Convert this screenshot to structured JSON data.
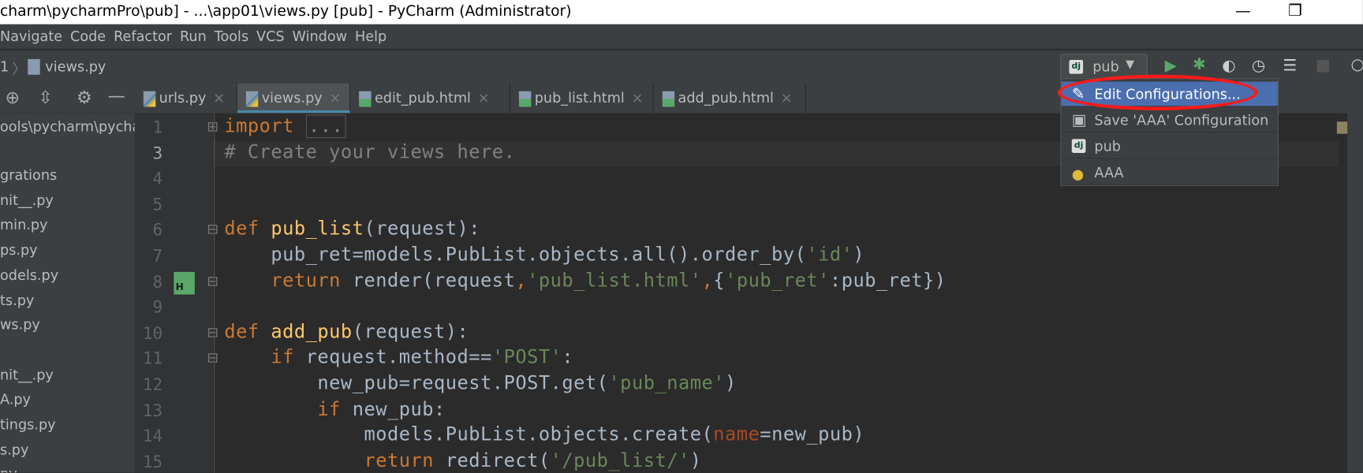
{
  "window": {
    "title": "charm\\pycharmPro\\pub] - ...\\app01\\views.py [pub] - PyCharm (Administrator)",
    "minimize": "—",
    "maximize": "❐"
  },
  "menu": [
    "Navigate",
    "Code",
    "Refactor",
    "Run",
    "Tools",
    "VCS",
    "Window",
    "Help"
  ],
  "breadcrumb": {
    "prefix": "1",
    "file": "views.py"
  },
  "run_config": {
    "selected": "pub",
    "icon": "django-icon"
  },
  "toolbar_icons": [
    "run-icon",
    "debug-icon",
    "coverage-icon",
    "profile-icon",
    "concurrency-icon",
    "stop-icon",
    "search-icon"
  ],
  "accent": "#4b6eaf",
  "highlight_ring": "#ff1a1a",
  "sidebar": {
    "path": "ools\\pycharm\\pycha",
    "items": [
      "grations",
      "nit__.py",
      "min.py",
      "ps.py",
      "odels.py",
      "ts.py",
      "ws.py",
      "",
      "nit__.py",
      "A.py",
      "tings.py",
      "s.py",
      "pv"
    ]
  },
  "tabs": [
    {
      "label": "urls.py",
      "type": "python"
    },
    {
      "label": "views.py",
      "type": "python",
      "active": true
    },
    {
      "label": "edit_pub.html",
      "type": "html"
    },
    {
      "label": "pub_list.html",
      "type": "html"
    },
    {
      "label": "add_pub.html",
      "type": "html"
    }
  ],
  "popup": [
    {
      "label": "Edit Configurations...",
      "icon": "pencil-icon",
      "selected": true
    },
    {
      "label": "Save 'AAA' Configuration",
      "icon": "save-icon"
    },
    {
      "label": "pub",
      "icon": "django-icon"
    },
    {
      "label": "AAA",
      "icon": "python-icon"
    }
  ],
  "code": [
    {
      "n": "1",
      "tokens": [
        [
          "kw",
          "import "
        ],
        [
          "fold",
          "..."
        ]
      ]
    },
    {
      "n": "3",
      "tokens": [
        [
          "cm",
          "# Create your views here."
        ]
      ]
    },
    {
      "n": "4",
      "tokens": []
    },
    {
      "n": "5",
      "tokens": []
    },
    {
      "n": "6",
      "tokens": [
        [
          "kw",
          "def "
        ],
        [
          "fn",
          "pub_list"
        ],
        [
          "txt",
          "(request):"
        ]
      ]
    },
    {
      "n": "7",
      "tokens": [
        [
          "txt",
          "    pub_ret=models.PubList.objects.all().order_by("
        ],
        [
          "str",
          "'id'"
        ],
        [
          "txt",
          ")"
        ]
      ]
    },
    {
      "n": "8",
      "tokens": [
        [
          "txt",
          "    "
        ],
        [
          "kw",
          "return "
        ],
        [
          "txt",
          "render(request"
        ],
        [
          "kw",
          ","
        ],
        [
          "str",
          "'pub_list.html'"
        ],
        [
          "kw",
          ","
        ],
        [
          "txt",
          "{"
        ],
        [
          "str",
          "'pub_ret'"
        ],
        [
          "txt",
          ":pub_ret})"
        ]
      ]
    },
    {
      "n": "9",
      "tokens": []
    },
    {
      "n": "10",
      "tokens": [
        [
          "kw",
          "def "
        ],
        [
          "fn",
          "add_pub"
        ],
        [
          "txt",
          "(request):"
        ]
      ]
    },
    {
      "n": "11",
      "tokens": [
        [
          "txt",
          "    "
        ],
        [
          "kw",
          "if "
        ],
        [
          "txt",
          "request.method=="
        ],
        [
          "str",
          "'POST'"
        ],
        [
          "txt",
          ":"
        ]
      ]
    },
    {
      "n": "12",
      "tokens": [
        [
          "txt",
          "        new_pub=request.POST.get("
        ],
        [
          "str",
          "'pub_name'"
        ],
        [
          "txt",
          ")"
        ]
      ]
    },
    {
      "n": "13",
      "tokens": [
        [
          "txt",
          "        "
        ],
        [
          "kw",
          "if "
        ],
        [
          "txt",
          "new_pub:"
        ]
      ]
    },
    {
      "n": "14",
      "tokens": [
        [
          "txt",
          "            models.PubList.objects.create("
        ],
        [
          "pa",
          "name"
        ],
        [
          "txt",
          "=new_pub)"
        ]
      ]
    },
    {
      "n": "15",
      "tokens": [
        [
          "txt",
          "            "
        ],
        [
          "kw",
          "return "
        ],
        [
          "txt",
          "redirect("
        ],
        [
          "str",
          "'/pub_list/'"
        ],
        [
          "txt",
          ")"
        ]
      ]
    }
  ]
}
